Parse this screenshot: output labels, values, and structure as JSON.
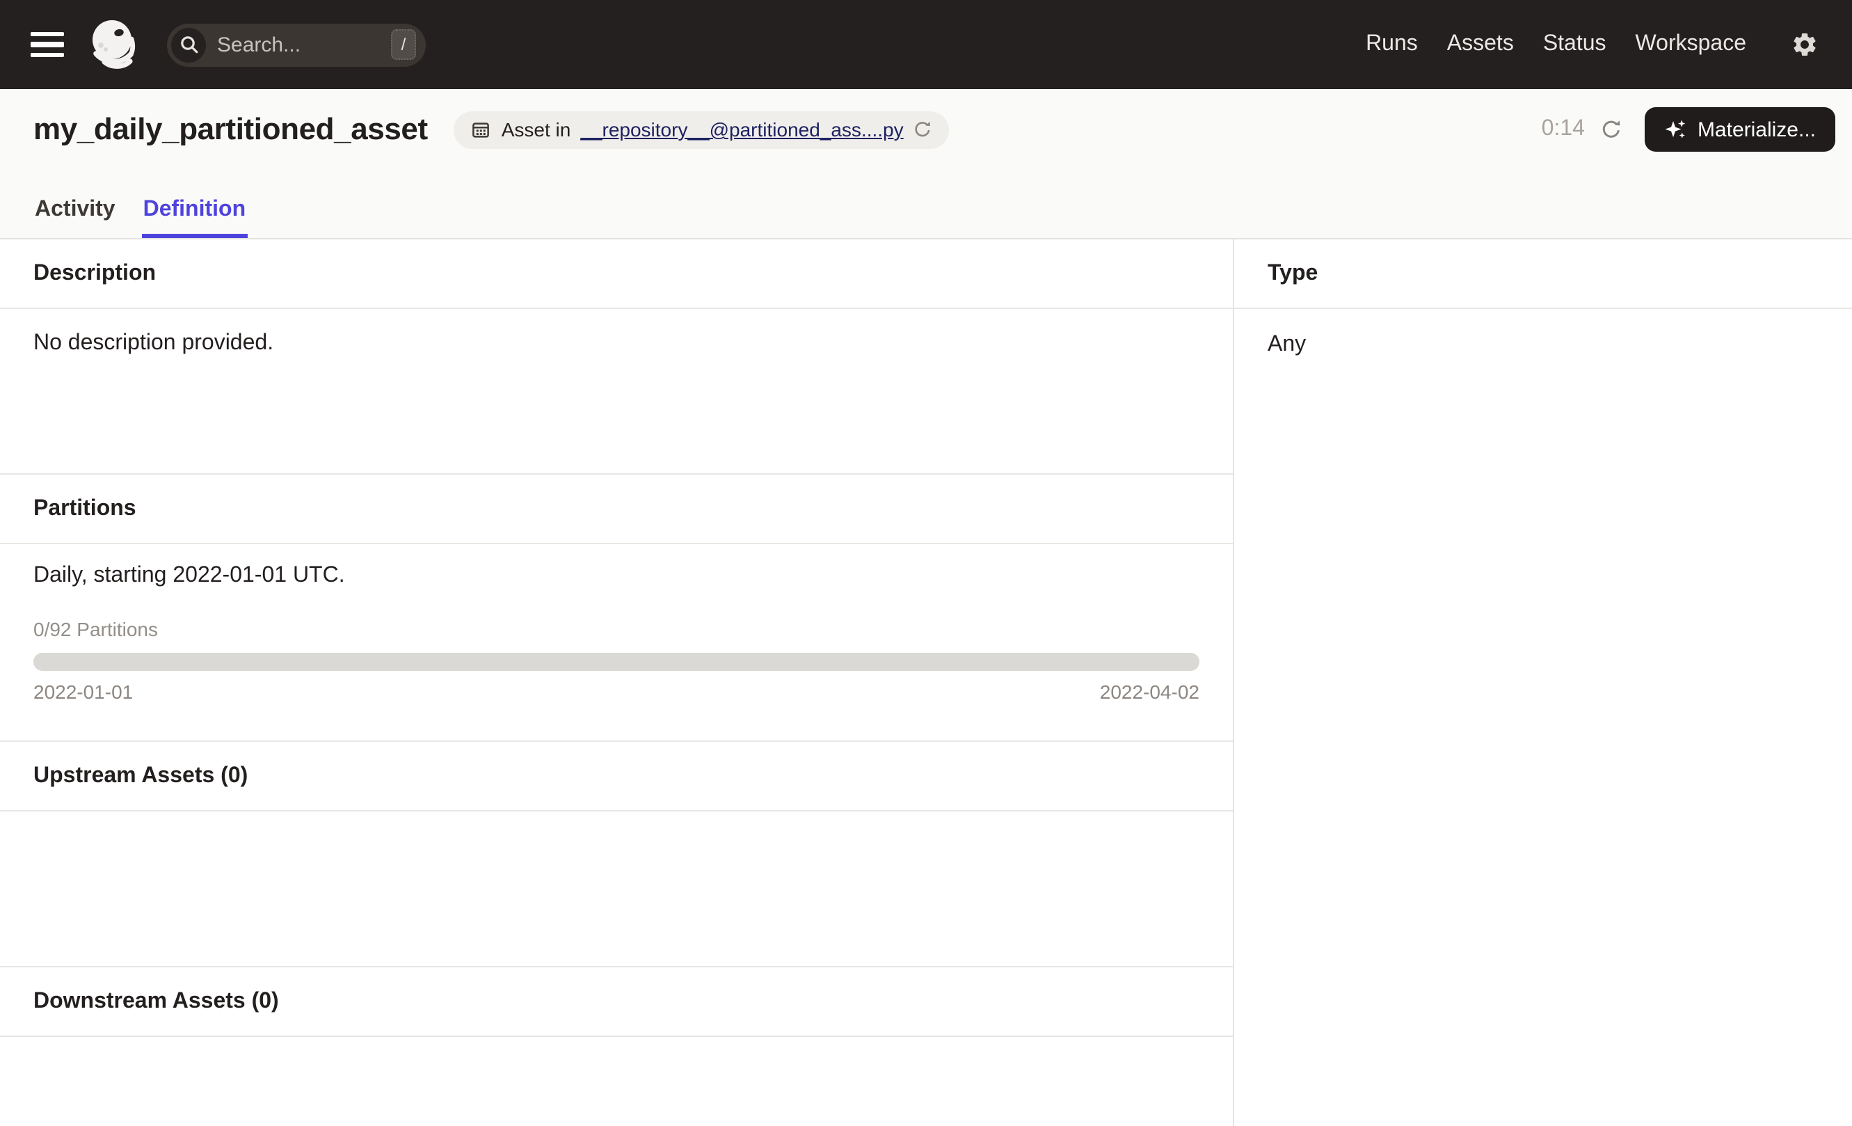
{
  "topbar": {
    "search": {
      "placeholder": "Search...",
      "shortcut": "/"
    },
    "nav": [
      {
        "label": "Runs"
      },
      {
        "label": "Assets"
      },
      {
        "label": "Status"
      },
      {
        "label": "Workspace"
      }
    ]
  },
  "header": {
    "title": "my_daily_partitioned_asset",
    "badge": {
      "prefix": "Asset in",
      "link": "__repository__@partitioned_ass....py"
    },
    "timer": "0:14",
    "materialize_label": "Materialize..."
  },
  "tabs": [
    {
      "label": "Activity",
      "active": false
    },
    {
      "label": "Definition",
      "active": true
    }
  ],
  "main": {
    "description": {
      "heading": "Description",
      "body": "No description provided."
    },
    "partitions": {
      "heading": "Partitions",
      "body": "Daily, starting 2022-01-01 UTC.",
      "count_label": "0/92 Partitions",
      "range_start": "2022-01-01",
      "range_end": "2022-04-02",
      "progress_percent": 0
    },
    "upstream": {
      "heading": "Upstream Assets (0)"
    },
    "downstream": {
      "heading": "Downstream Assets (0)"
    },
    "type": {
      "heading": "Type",
      "value": "Any"
    }
  },
  "icons": {
    "menu": "hamburger-icon",
    "logo": "dagster-logo",
    "search": "magnifier-icon",
    "shortcut_key": "slash-key",
    "settings": "gear-icon",
    "repository": "repo-grid-icon",
    "reload": "refresh-icon",
    "materialize": "sparkles-icon"
  },
  "colors": {
    "topbar_bg": "#242020",
    "header_bg": "#FAFAF8",
    "accent": "#4F43DD",
    "link": "#1D2160",
    "divider": "#E9E6E3",
    "progress_track": "#DBD9D6",
    "muted_text": "#948E89",
    "button_bg": "#1F1C1B"
  }
}
